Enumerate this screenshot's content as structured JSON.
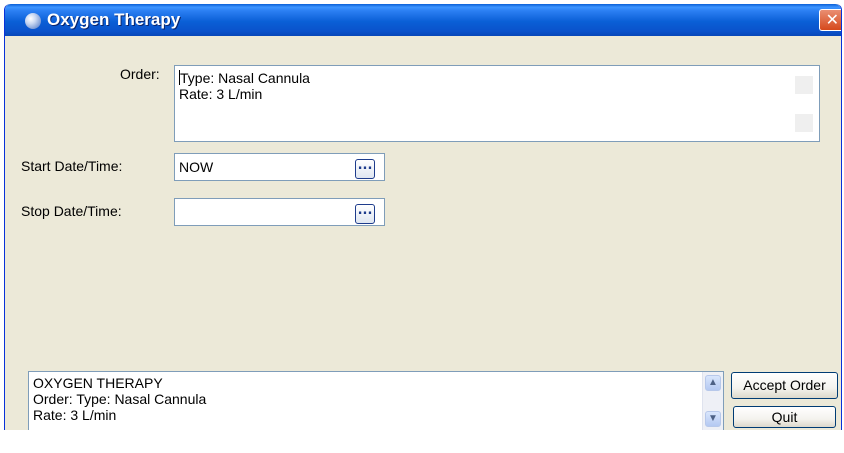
{
  "window": {
    "title": "Oxygen Therapy",
    "close_glyph": "✕",
    "icon": "app-globe-icon"
  },
  "form": {
    "order_label": "Order:",
    "order_lines": [
      "Type: Nasal Cannula",
      "Rate: 3 L/min"
    ],
    "start_label": "Start Date/Time:",
    "start_value": "NOW",
    "stop_label": "Stop Date/Time:",
    "stop_value": "",
    "picker_glyph": "..."
  },
  "summary": {
    "lines": [
      "OXYGEN THERAPY",
      "Order:  Type: Nasal Cannula",
      "Rate: 3 L/min"
    ],
    "scroll_up_glyph": "▲",
    "scroll_down_glyph": "▼"
  },
  "buttons": {
    "accept": "Accept Order",
    "quit": "Quit"
  },
  "colors": {
    "titlebar": "#0a5fd6",
    "dialog_bg": "#ece9d8",
    "field_border": "#7f9db9",
    "close": "#d6491c"
  }
}
